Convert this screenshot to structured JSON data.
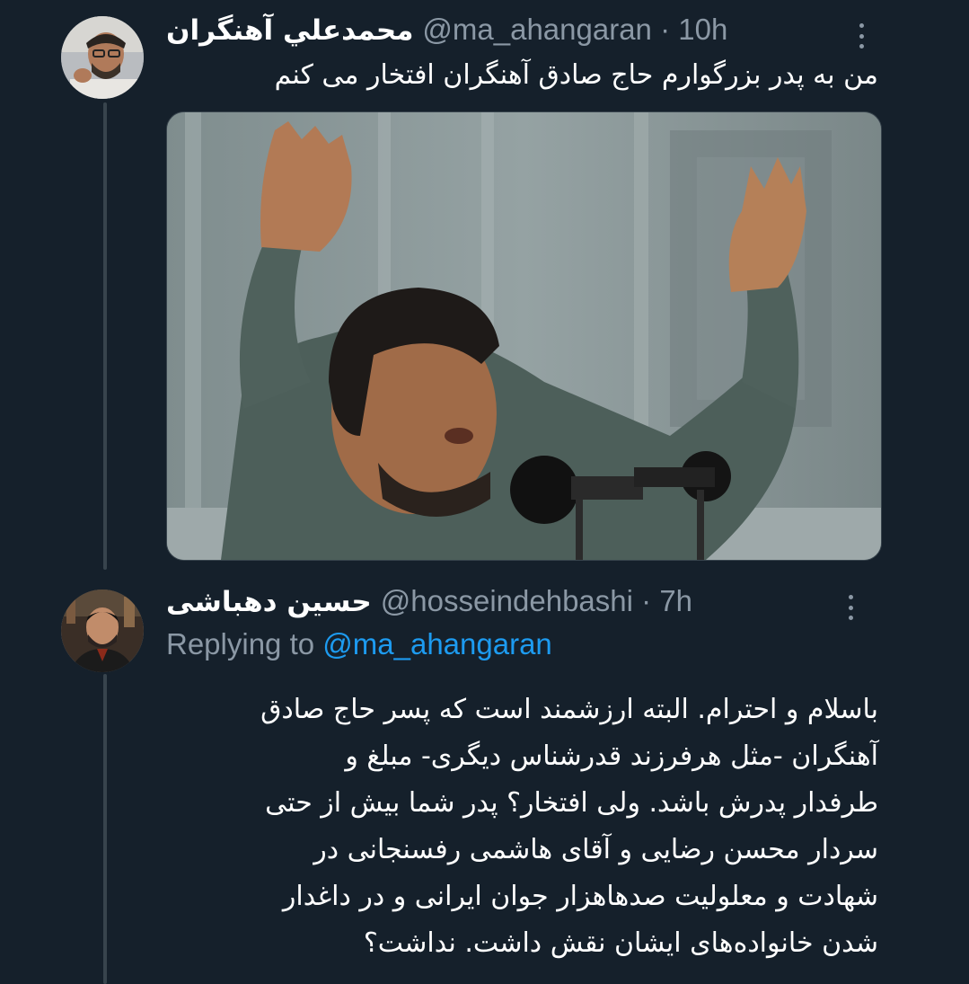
{
  "tweet": {
    "author_name": "محمدعلي آهنگران",
    "handle": "@ma_ahangaran",
    "separator": "·",
    "time": "10h",
    "text": "من به پدر بزرگوارم حاج صادق آهنگران افتخار می کنم",
    "media_icon": "photo-speaker-with-raised-arms"
  },
  "reply": {
    "author_name": "حسین دهباشی",
    "handle": "@hosseindehbashi",
    "separator": "·",
    "time": "7h",
    "replying_prefix": "Replying to",
    "replying_mention": "@ma_ahangaran",
    "lines": [
      "باسلام و احترام. البته ارزشمند است که پسر حاج صادق",
      "آهنگران -مثل هرفرزند قدرشناس دیگری- مبلغ و",
      "طرفدار پدرش باشد. ولی افتخار؟ پدر شما بیش از حتی",
      "سردار محسن رضایی و آقای هاشمی رفسنجانی در",
      "شهادت و معلولیت صدهاهزار جوان ایرانی و در داغدار",
      "شدن خانواده‌های ایشان نقش داشت. نداشت؟"
    ]
  },
  "colors": {
    "background": "#15202b",
    "text": "#ffffff",
    "muted": "#8b98a5",
    "link": "#1d9bf0",
    "border": "#38444d"
  },
  "icons": [
    "more-options-icon",
    "avatar-photo"
  ]
}
